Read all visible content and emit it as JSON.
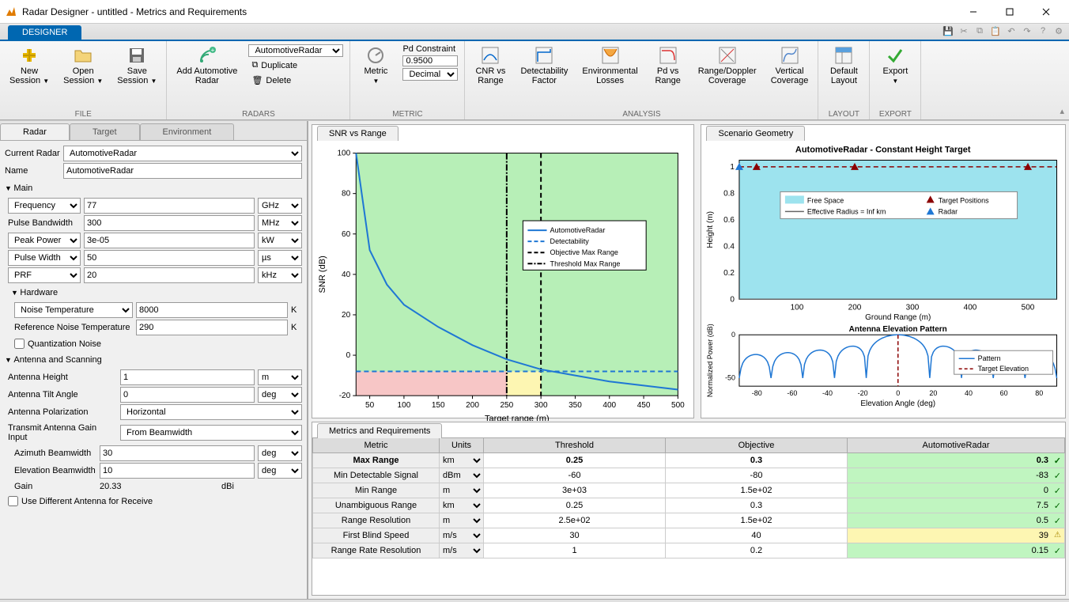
{
  "window": {
    "title": "Radar Designer - untitled - Metrics and Requirements"
  },
  "ribbon": {
    "tab": "DESIGNER"
  },
  "toolstrip": {
    "file_group": "FILE",
    "new_session": "New\nSession",
    "open_session": "Open\nSession",
    "save_session": "Save\nSession",
    "radars_group": "RADARS",
    "add_radar": "Add Automotive\nRadar",
    "radar_select": "AutomotiveRadar",
    "duplicate": "Duplicate",
    "delete": "Delete",
    "metric_group": "METRIC",
    "metric": "Metric",
    "pd_constraint": "Pd Constraint",
    "pd_value": "0.9500",
    "decimal": "Decimal",
    "analysis_group": "ANALYSIS",
    "cnr": "CNR vs\nRange",
    "detect": "Detectability\nFactor",
    "env": "Environmental\nLosses",
    "pdrange": "Pd vs\nRange",
    "doppler": "Range/Doppler\nCoverage",
    "vertical": "Vertical\nCoverage",
    "layout_group": "LAYOUT",
    "default_layout": "Default\nLayout",
    "export_group": "EXPORT",
    "export": "Export"
  },
  "tabs": {
    "radar": "Radar",
    "target": "Target",
    "environment": "Environment"
  },
  "props": {
    "current_radar_lbl": "Current Radar",
    "current_radar_val": "AutomotiveRadar",
    "name_lbl": "Name",
    "name_val": "AutomotiveRadar",
    "main_head": "Main",
    "frequency_lbl": "Frequency",
    "frequency_val": "77",
    "frequency_unit": "GHz",
    "pulse_bw_lbl": "Pulse Bandwidth",
    "pulse_bw_val": "300",
    "pulse_bw_unit": "MHz",
    "peak_power_lbl": "Peak Power",
    "peak_power_val": "3e-05",
    "peak_power_unit": "kW",
    "pulse_width_lbl": "Pulse Width",
    "pulse_width_val": "50",
    "pulse_width_unit": "µs",
    "prf_lbl": "PRF",
    "prf_val": "20",
    "prf_unit": "kHz",
    "hardware_head": "Hardware",
    "noise_temp_lbl": "Noise Temperature",
    "noise_temp_val": "8000",
    "noise_temp_unit": "K",
    "ref_noise_lbl": "Reference Noise Temperature",
    "ref_noise_val": "290",
    "ref_noise_unit": "K",
    "quant_lbl": "Quantization Noise",
    "antenna_head": "Antenna and Scanning",
    "ant_height_lbl": "Antenna Height",
    "ant_height_val": "1",
    "ant_height_unit": "m",
    "tilt_lbl": "Antenna Tilt Angle",
    "tilt_val": "0",
    "tilt_unit": "deg",
    "polar_lbl": "Antenna Polarization",
    "polar_val": "Horizontal",
    "gain_input_lbl": "Transmit Antenna Gain Input",
    "gain_input_val": "From Beamwidth",
    "az_bw_lbl": "Azimuth Beamwidth",
    "az_bw_val": "30",
    "az_bw_unit": "deg",
    "el_bw_lbl": "Elevation Beamwidth",
    "el_bw_val": "10",
    "el_bw_unit": "deg",
    "gain_lbl": "Gain",
    "gain_val": "20.33",
    "gain_unit": "dBi",
    "diff_ant_lbl": "Use Different Antenna for Receive"
  },
  "snr_chart": {
    "tab": "SNR vs Range",
    "xlabel": "Target range (m)",
    "ylabel": "SNR (dB)",
    "legend": [
      "AutomotiveRadar",
      "Detectability",
      "Objective Max Range",
      "Threshold Max Range"
    ]
  },
  "scenario": {
    "tab": "Scenario Geometry",
    "title": "AutomotiveRadar - Constant Height Target",
    "xlabel": "Ground Range (m)",
    "ylabel": "Height (m)",
    "legend": [
      "Free Space",
      "Effective Radius = Inf km",
      "Target Positions",
      "Radar"
    ],
    "elev_title": "Antenna Elevation Pattern",
    "elev_xlabel": "Elevation Angle (deg)",
    "elev_ylabel": "Normalized Power (dB)",
    "elev_legend": [
      "Pattern",
      "Target Elevation"
    ]
  },
  "metrics_tab": "Metrics and Requirements",
  "metrics": {
    "headers": [
      "Metric",
      "Units",
      "Threshold",
      "Objective",
      "AutomotiveRadar"
    ],
    "rows": [
      {
        "name": "Max Range",
        "unit": "km",
        "threshold": "0.25",
        "objective": "0.3",
        "value": "0.3",
        "status": "pass",
        "bold": true
      },
      {
        "name": "Min Detectable Signal",
        "unit": "dBm",
        "threshold": "-60",
        "objective": "-80",
        "value": "-83",
        "status": "pass"
      },
      {
        "name": "Min Range",
        "unit": "m",
        "threshold": "3e+03",
        "objective": "1.5e+02",
        "value": "0",
        "status": "pass"
      },
      {
        "name": "Unambiguous Range",
        "unit": "km",
        "threshold": "0.25",
        "objective": "0.3",
        "value": "7.5",
        "status": "pass"
      },
      {
        "name": "Range Resolution",
        "unit": "m",
        "threshold": "2.5e+02",
        "objective": "1.5e+02",
        "value": "0.5",
        "status": "pass"
      },
      {
        "name": "First Blind Speed",
        "unit": "m/s",
        "threshold": "30",
        "objective": "40",
        "value": "39",
        "status": "warn"
      },
      {
        "name": "Range Rate Resolution",
        "unit": "m/s",
        "threshold": "1",
        "objective": "0.2",
        "value": "0.15",
        "status": "pass"
      }
    ]
  },
  "chart_data": [
    {
      "type": "line",
      "title": "SNR vs Range",
      "xlabel": "Target range (m)",
      "ylabel": "SNR (dB)",
      "xlim": [
        30,
        500
      ],
      "ylim": [
        -20,
        100
      ],
      "xticks": [
        50,
        100,
        150,
        200,
        250,
        300,
        350,
        400,
        450,
        500
      ],
      "yticks": [
        -20,
        0,
        20,
        40,
        60,
        80,
        100
      ],
      "series": [
        {
          "name": "AutomotiveRadar",
          "x": [
            30,
            50,
            75,
            100,
            150,
            200,
            250,
            300,
            350,
            400,
            450,
            500
          ],
          "y": [
            100,
            52,
            35,
            25,
            14,
            5,
            -2,
            -7,
            -10,
            -13,
            -15,
            -17
          ]
        },
        {
          "name": "Detectability",
          "x": [
            30,
            500
          ],
          "y": [
            -8,
            -8
          ]
        }
      ],
      "vlines": [
        {
          "name": "Objective Max Range",
          "x": 300
        },
        {
          "name": "Threshold Max Range",
          "x": 250
        }
      ],
      "regions": [
        {
          "color": "green",
          "x": [
            30,
            500
          ],
          "y": [
            -8,
            100
          ]
        },
        {
          "color": "red",
          "x": [
            30,
            250
          ],
          "y": [
            -20,
            -8
          ]
        },
        {
          "color": "yellow",
          "x": [
            250,
            300
          ],
          "y": [
            -20,
            -8
          ]
        },
        {
          "color": "green",
          "x": [
            300,
            500
          ],
          "y": [
            -20,
            -8
          ]
        }
      ]
    },
    {
      "type": "scatter",
      "title": "AutomotiveRadar - Constant Height Target",
      "xlabel": "Ground Range (m)",
      "ylabel": "Height (m)",
      "xlim": [
        0,
        550
      ],
      "ylim": [
        0,
        1.05
      ],
      "xticks": [
        100,
        200,
        300,
        400,
        500
      ],
      "yticks": [
        0,
        0.2,
        0.4,
        0.6,
        0.8,
        1
      ],
      "series": [
        {
          "name": "Radar",
          "x": [
            0
          ],
          "y": [
            1
          ],
          "marker": "triangle",
          "color": "#1f77b4"
        },
        {
          "name": "Target Positions",
          "x": [
            30,
            200,
            500
          ],
          "y": [
            1,
            1,
            1
          ],
          "marker": "triangle",
          "color": "#8b0000"
        },
        {
          "name": "Effective Radius = Inf km",
          "x": [
            0,
            550
          ],
          "y": [
            0,
            0
          ],
          "style": "line"
        }
      ]
    },
    {
      "type": "line",
      "title": "Antenna Elevation Pattern",
      "xlabel": "Elevation Angle (deg)",
      "ylabel": "Normalized Power (dB)",
      "xlim": [
        -90,
        90
      ],
      "ylim": [
        -60,
        0
      ],
      "xticks": [
        -80,
        -60,
        -40,
        -20,
        0,
        20,
        40,
        60,
        80
      ],
      "yticks": [
        -50,
        0
      ],
      "series": [
        {
          "name": "Pattern",
          "type": "sinc-pattern",
          "mainlobe_width": 10,
          "sidelobes": 8
        },
        {
          "name": "Target Elevation",
          "x": [
            0,
            0
          ],
          "y": [
            -60,
            0
          ],
          "style": "dashed",
          "color": "#8b0000"
        }
      ]
    }
  ]
}
